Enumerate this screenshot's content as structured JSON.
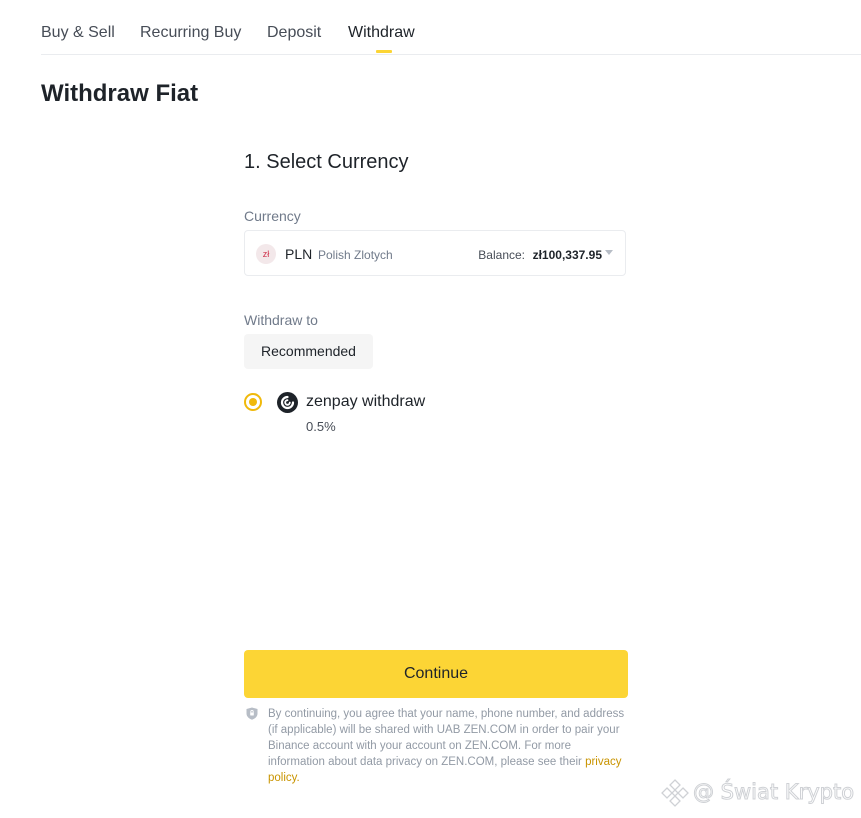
{
  "tabs": [
    {
      "label": "Buy & Sell",
      "active": false
    },
    {
      "label": "Recurring Buy",
      "active": false
    },
    {
      "label": "Deposit",
      "active": false
    },
    {
      "label": "Withdraw",
      "active": true
    }
  ],
  "page_title": "Withdraw Fiat",
  "step_title": "1. Select Currency",
  "currency": {
    "label": "Currency",
    "icon_text": "zł",
    "code": "PLN",
    "name": "Polish Zlotych",
    "balance_label": "Balance:",
    "balance_value": "zł100,337.95"
  },
  "withdraw_to": {
    "label": "Withdraw to",
    "chip": "Recommended",
    "method": {
      "name": "zenpay withdraw",
      "fee": "0.5%",
      "selected": true
    }
  },
  "continue_label": "Continue",
  "disclaimer": {
    "text": "By continuing, you agree that your name, phone number, and address (if applicable) will be shared with UAB ZEN.COM in order to pair your Binance account with your account on ZEN.COM. For more information about data privacy on ZEN.COM, please see their",
    "link": "privacy policy."
  },
  "watermark": "@ Świat Krypto",
  "colors": {
    "accent": "#fcd535",
    "radio": "#f0b90b",
    "link": "#c99400",
    "text": "#1e2329",
    "muted": "#707a8a"
  },
  "icons": [
    "pln-icon",
    "caret-down-icon",
    "radio-selected-icon",
    "zenpay-icon",
    "shield-icon",
    "binance-logo-icon"
  ]
}
